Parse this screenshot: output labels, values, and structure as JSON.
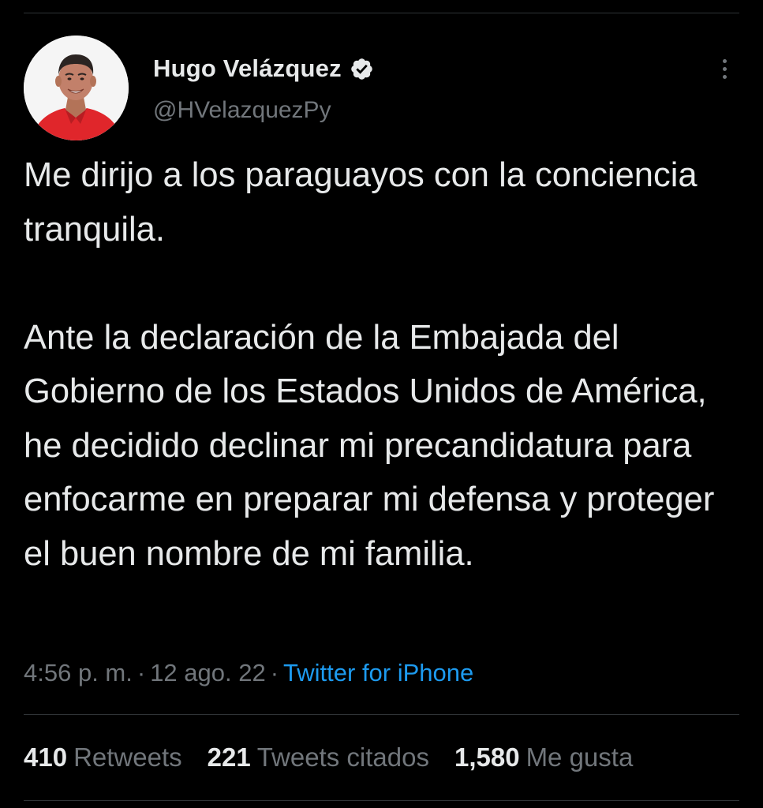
{
  "author": {
    "display_name": "Hugo Velázquez",
    "handle": "@HVelazquezPy",
    "verified": true,
    "avatar_icon": "profile-photo",
    "verified_icon": "verified-badge-icon",
    "verified_color": "#e7e9ea"
  },
  "tweet": {
    "paragraph_1": "Me dirijo a los paraguayos con la conciencia tranquila.",
    "paragraph_2": "Ante la declaración de la Embajada del Gobierno de los Estados Unidos de América, he decidido declinar mi precandidatura para enfocarme en preparar mi defensa y proteger el buen nombre de mi familia."
  },
  "meta": {
    "time": "4:56 p. m.",
    "separator": "·",
    "date": "12 ago. 22",
    "source": "Twitter for iPhone",
    "source_color": "#1d9bf0"
  },
  "stats": {
    "retweets_count": "410",
    "retweets_label": "Retweets",
    "quotes_count": "221",
    "quotes_label": "Tweets citados",
    "likes_count": "1,580",
    "likes_label": "Me gusta"
  },
  "menu": {
    "more_icon": "more-vertical-icon"
  },
  "theme": {
    "background": "#000000",
    "text": "#e7e9ea",
    "secondary_text": "#71767b",
    "divider": "#2f3336"
  }
}
